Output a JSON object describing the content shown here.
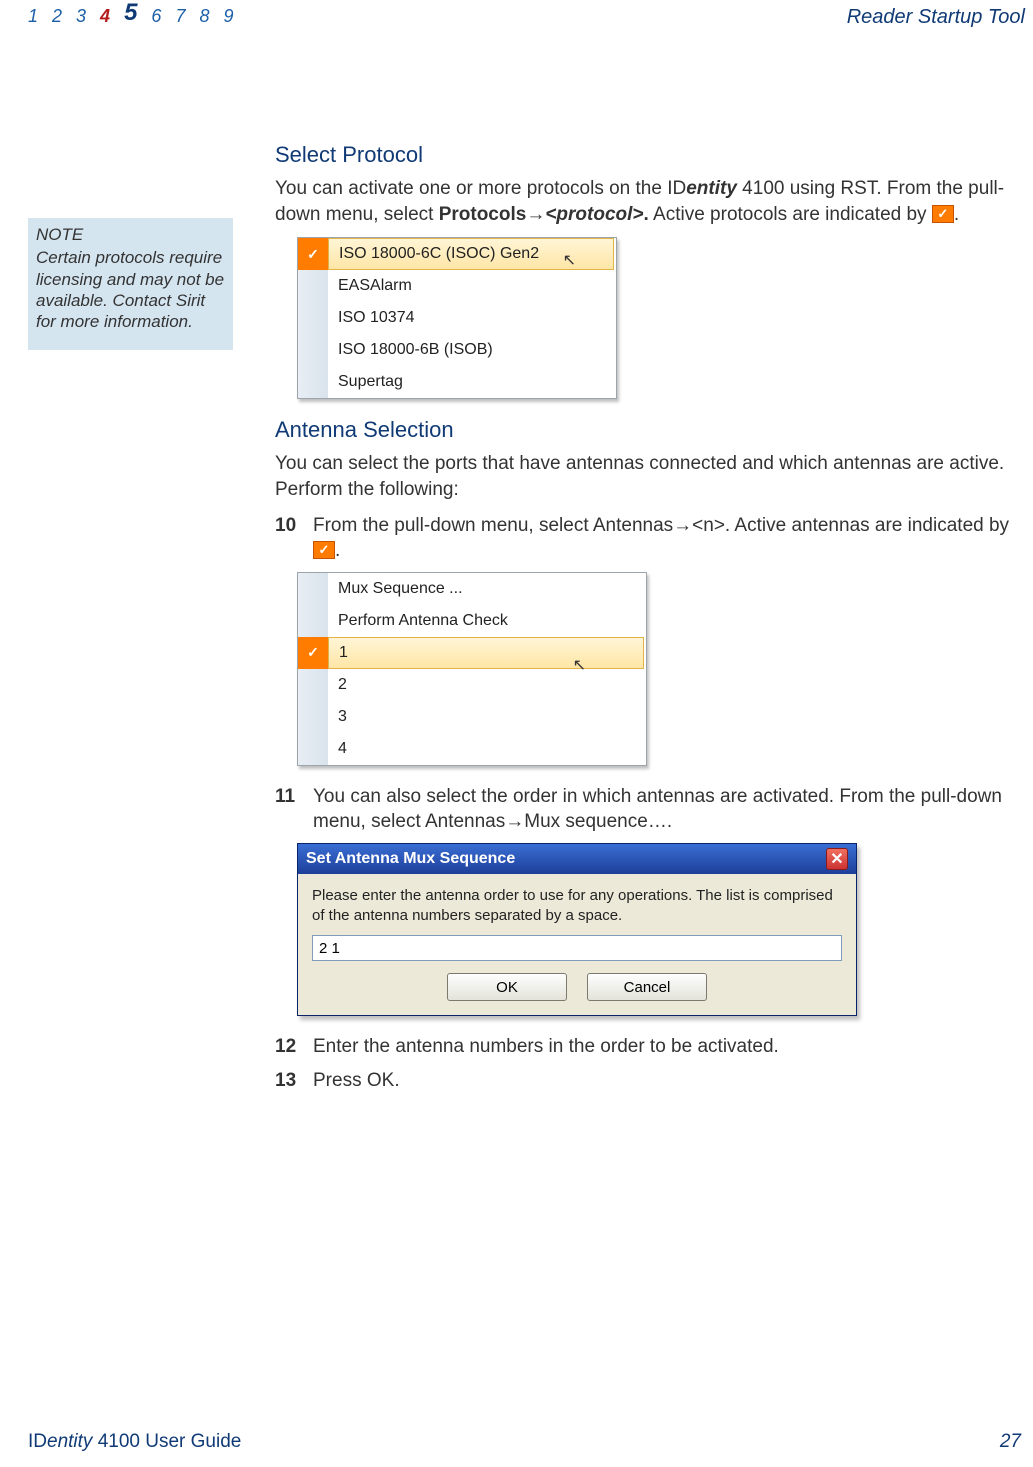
{
  "header": {
    "crumbs": [
      "1",
      "2",
      "3",
      "4",
      "5",
      "6",
      "7",
      "8",
      "9"
    ],
    "title": "Reader Startup Tool"
  },
  "note": {
    "label": "NOTE",
    "text": "Certain protocols require licensing and may not be available. Contact Sirit for more information."
  },
  "section1": {
    "heading": "Select Protocol",
    "p1a": "You can activate one or more protocols on the ID",
    "p1_em": "entity",
    "p1b": " 4100 using RST. From the pull-down menu, select ",
    "p1_bold1": "Protocols",
    "p1_arrow": "→",
    "p1_bolditalic": "<protocol>",
    "p1_bold2": ".",
    "p1c": " Active protocols are indicated by ",
    "p1d": "."
  },
  "protocol_menu": {
    "items": [
      {
        "label": "ISO 18000-6C (ISOC) Gen2",
        "checked": true,
        "hl": true
      },
      {
        "label": "EASAlarm",
        "checked": false,
        "hl": false
      },
      {
        "label": "ISO 10374",
        "checked": false,
        "hl": false
      },
      {
        "label": "ISO 18000-6B (ISOB)",
        "checked": false,
        "hl": false
      },
      {
        "label": "Supertag",
        "checked": false,
        "hl": false
      }
    ]
  },
  "section2": {
    "heading": "Antenna Selection",
    "p1": "You can select the ports that have antennas connected and which antennas are active. Perform the following:"
  },
  "steps": {
    "s10_num": "10",
    "s10a": "From the pull-down menu, select ",
    "s10_bold1": "Antennas",
    "s10_arrow": "→",
    "s10_bold2": "<n>",
    "s10b": ".  Active antennas are indicated by ",
    "s10c": ".",
    "s11_num": "11",
    "s11a": "You can also select the order in which antennas are activated. From the pull-down menu, select ",
    "s11_bold": "Antennas→Mux sequence…",
    "s11b": ".",
    "s12_num": "12",
    "s12": "Enter the antenna numbers in the order to be activated.",
    "s13_num": "13",
    "s13a": "Press ",
    "s13_bold": "OK",
    "s13b": "."
  },
  "antenna_menu": {
    "items": [
      {
        "label": "Mux Sequence ...",
        "checked": false,
        "hl": false
      },
      {
        "label": "Perform Antenna Check",
        "checked": false,
        "hl": false
      },
      {
        "label": "1",
        "checked": true,
        "hl": true
      },
      {
        "label": "2",
        "checked": false,
        "hl": false
      },
      {
        "label": "3",
        "checked": false,
        "hl": false
      },
      {
        "label": "4",
        "checked": false,
        "hl": false
      }
    ]
  },
  "dialog": {
    "title": "Set Antenna Mux Sequence",
    "msg": "Please enter the antenna order to use for any operations. The list is comprised of the antenna numbers separated by a space.",
    "value": "2 1",
    "ok": "OK",
    "cancel": "Cancel"
  },
  "footer": {
    "left_a": "ID",
    "left_em": "entity",
    "left_b": " 4100 User Guide",
    "page": "27"
  }
}
